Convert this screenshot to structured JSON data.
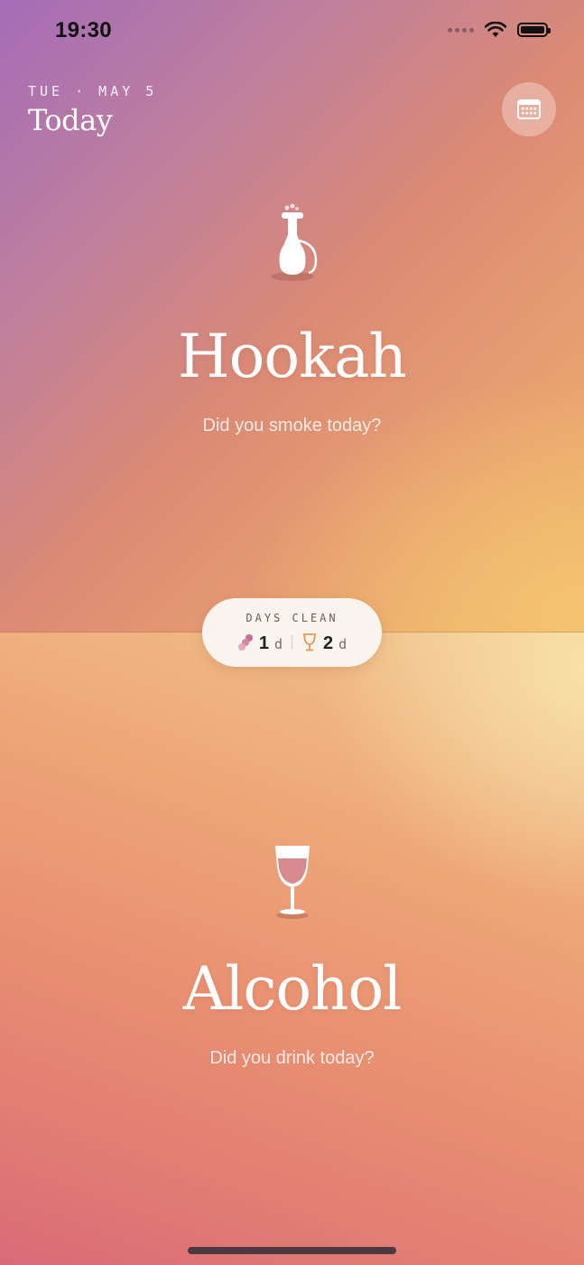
{
  "status_bar": {
    "time": "19:30",
    "signal_icon": "signal-dots-icon",
    "wifi_icon": "wifi-icon",
    "battery_icon": "battery-icon"
  },
  "header": {
    "date": "TUE · MAY 5",
    "title": "Today",
    "calendar_icon": "calendar-icon"
  },
  "habits": [
    {
      "title": "Hookah",
      "question": "Did you smoke today?",
      "icon": "hookah-icon"
    },
    {
      "title": "Alcohol",
      "question": "Did you drink today?",
      "icon": "wine-glass-icon"
    }
  ],
  "days_clean": {
    "title": "DAYS CLEAN",
    "stats": [
      {
        "icon": "hookah-small-icon",
        "value": "1",
        "unit": "d"
      },
      {
        "icon": "wine-glass-small-icon",
        "value": "2",
        "unit": "d"
      }
    ]
  },
  "colors": {
    "accent_purple": "#a56cb8",
    "accent_orange": "#e59a72",
    "accent_gold": "#eeb46c",
    "pill_bg": "#faf4ee"
  }
}
